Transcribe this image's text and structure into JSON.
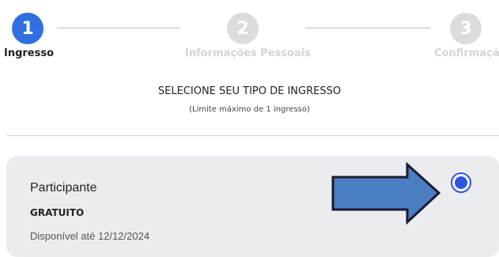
{
  "steps": [
    {
      "number": "1",
      "label": "Ingresso",
      "state": "active"
    },
    {
      "number": "2",
      "label": "Informações Pessoais",
      "state": "inactive"
    },
    {
      "number": "3",
      "label": "Confirmação",
      "state": "inactive"
    }
  ],
  "section": {
    "title": "SELECIONE SEU TIPO DE INGRESSO",
    "subtitle": "(Limite máximo de 1 ingresso)"
  },
  "ticket": {
    "name": "Participante",
    "price": "GRATUITO",
    "availability": "Disponível até 12/12/2024",
    "selected": true
  },
  "colors": {
    "accent": "#2f6fe0",
    "inactive_step": "#dcdcdc",
    "card_bg": "#eaecf0",
    "arrow_fill": "#4a7ec0",
    "arrow_stroke": "#1a1a2e"
  }
}
